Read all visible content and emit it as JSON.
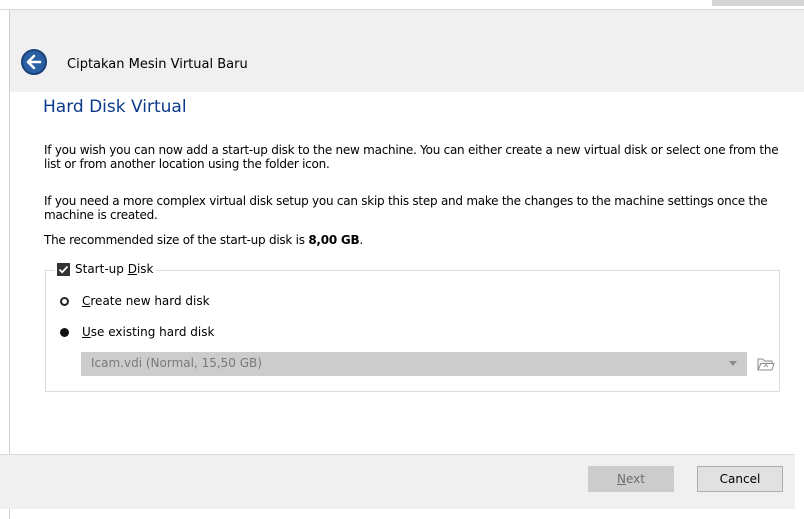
{
  "window": {
    "title": "Ciptakan Mesin Virtual Baru"
  },
  "page": {
    "title": "Hard Disk Virtual",
    "paragraph1": "If you wish you can now add a start-up disk to the new machine. You can either create a new virtual disk or select one from the list or from another location using the folder icon.",
    "paragraph2": "If you need a more complex virtual disk setup you can skip this step and make the changes to the machine settings once the machine is created.",
    "recommended_prefix": "The recommended size of the start-up disk is ",
    "recommended_size": "8,00 GB",
    "recommended_suffix": "."
  },
  "startup_disk": {
    "label_pre": "Start-up ",
    "label_u": "D",
    "label_post": "isk",
    "checked": true,
    "options": [
      {
        "u": "C",
        "rest": "reate new hard disk",
        "selected": false
      },
      {
        "u": "U",
        "rest": "se existing hard disk",
        "selected": true
      }
    ],
    "combo_value": "Icam.vdi (Normal, 15,50 GB)",
    "combo_enabled": false
  },
  "footer": {
    "next_u": "N",
    "next_rest": "ext",
    "cancel": "Cancel"
  },
  "icons": {
    "back": "back-arrow-icon",
    "folder": "folder-open-icon",
    "dropdown": "chevron-down-icon"
  },
  "colors": {
    "title_blue": "#0b3a8c",
    "back_button": "#2a5fa3",
    "disabled_fill": "#cccccc"
  }
}
